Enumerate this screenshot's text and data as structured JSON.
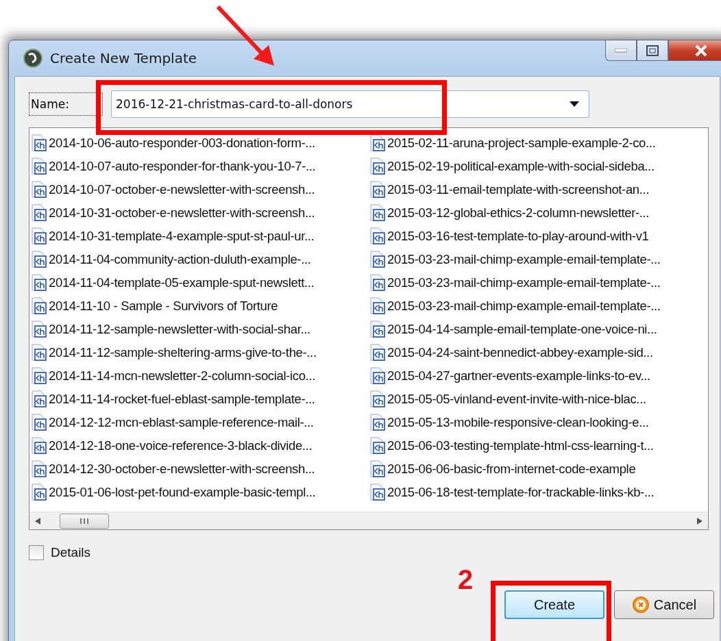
{
  "window": {
    "title": "Create New Template"
  },
  "name_field": {
    "label": "Name:",
    "value": "2016-12-21-christmas-card-to-all-donors"
  },
  "template_list": {
    "columns": [
      {
        "items": [
          "2014-10-06-auto-responder-003-donation-form-...",
          "2014-10-07-auto-responder-for-thank-you-10-7-...",
          "2014-10-07-october-e-newsletter-with-screensh...",
          "2014-10-31-october-e-newsletter-with-screensh...",
          "2014-10-31-template-4-example-sput-st-paul-ur...",
          "2014-11-04-community-action-duluth-example-...",
          "2014-11-04-template-05-example-sput-newslett...",
          "2014-11-10 - Sample - Survivors of Torture",
          "2014-11-12-sample-newsletter-with-social-shar...",
          "2014-11-12-sample-sheltering-arms-give-to-the-...",
          "2014-11-14-mcn-newsletter-2-column-social-ico...",
          "2014-11-14-rocket-fuel-eblast-sample-template-...",
          "2014-12-12-mcn-eblast-sample-reference-mail-...",
          "2014-12-18-one-voice-reference-3-black-divide...",
          "2014-12-30-october-e-newsletter-with-screensh...",
          "2015-01-06-lost-pet-found-example-basic-templ..."
        ]
      },
      {
        "items": [
          "2015-02-11-aruna-project-sample-example-2-co...",
          "2015-02-19-political-example-with-social-sideba...",
          "2015-03-11-email-template-with-screenshot-an...",
          "2015-03-12-global-ethics-2-column-newsletter-...",
          "2015-03-16-test-template-to-play-around-with-v1",
          "2015-03-23-mail-chimp-example-email-template-...",
          "2015-03-23-mail-chimp-example-email-template-...",
          "2015-03-23-mail-chimp-example-email-template-...",
          "2015-04-14-sample-email-template-one-voice-ni...",
          "2015-04-24-saint-bennedict-abbey-example-sid...",
          "2015-04-27-gartner-events-example-links-to-ev...",
          "2015-05-05-vinland-event-invite-with-nice-blac...",
          "2015-05-13-mobile-responsive-clean-looking-e...",
          "2015-06-03-testing-template-html-css-learning-t...",
          "2015-06-06-basic-from-internet-code-example",
          "2015-06-18-test-template-for-trackable-links-kb-..."
        ]
      }
    ]
  },
  "details": {
    "label": "Details",
    "checked": false
  },
  "buttons": [
    {
      "label": "Create",
      "kind": "default"
    },
    {
      "label": "Cancel",
      "kind": "cancel"
    }
  ],
  "annotations": {
    "step_label": "2"
  }
}
